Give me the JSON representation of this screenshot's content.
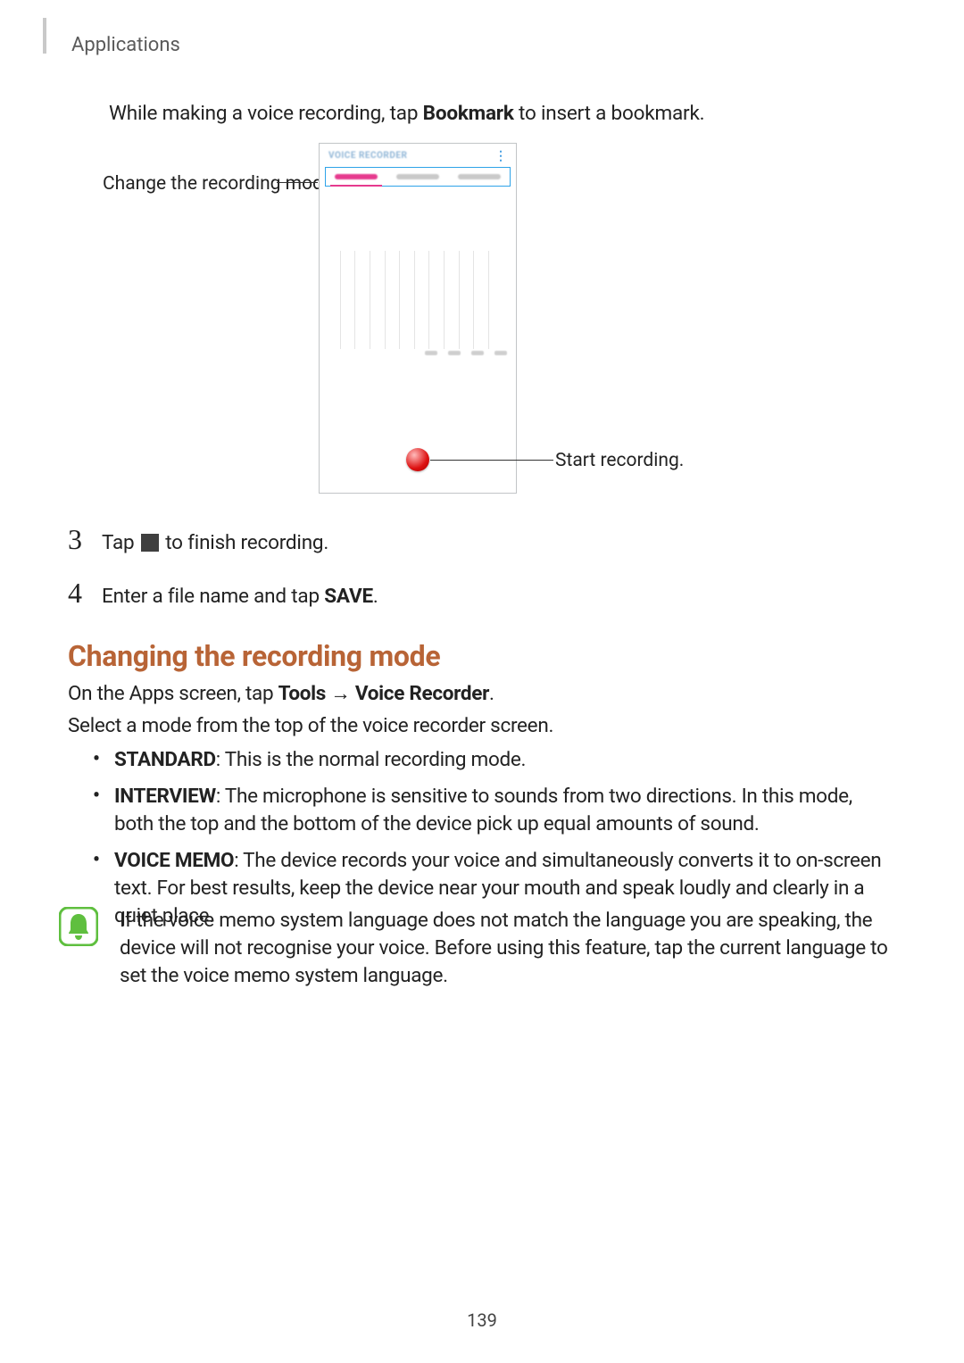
{
  "breadcrumb": "Applications",
  "intro": {
    "pre": "While making a voice recording, tap ",
    "bold": "Bookmark",
    "post": " to insert a bookmark."
  },
  "callouts": {
    "mode": "Change the recording mode.",
    "start": "Start recording."
  },
  "phone": {
    "title": "VOICE RECORDER"
  },
  "step3": {
    "num": "3",
    "pre": "Tap ",
    "post": " to finish recording."
  },
  "step4": {
    "num": "4",
    "pre": "Enter a file name and tap ",
    "bold": "SAVE",
    "post": "."
  },
  "heading": "Changing the recording mode",
  "p1": {
    "pre": "On the Apps screen, tap ",
    "b1": "Tools",
    "arrow": " → ",
    "b2": "Voice Recorder",
    "post": "."
  },
  "p2": "Select a mode from the top of the voice recorder screen.",
  "bullets": {
    "b1": {
      "label": "STANDARD",
      "text": ": This is the normal recording mode."
    },
    "b2": {
      "label": "INTERVIEW",
      "text": ": The microphone is sensitive to sounds from two directions. In this mode, both the top and the bottom of the device pick up equal amounts of sound."
    },
    "b3": {
      "label": "VOICE MEMO",
      "text": ": The device records your voice and simultaneously converts it to on-screen text. For best results, keep the device near your mouth and speak loudly and clearly in a quiet place."
    }
  },
  "note": "If the voice memo system language does not match the language you are speaking, the device will not recognise your voice. Before using this feature, tap the current language to set the voice memo system language.",
  "page_number": "139"
}
